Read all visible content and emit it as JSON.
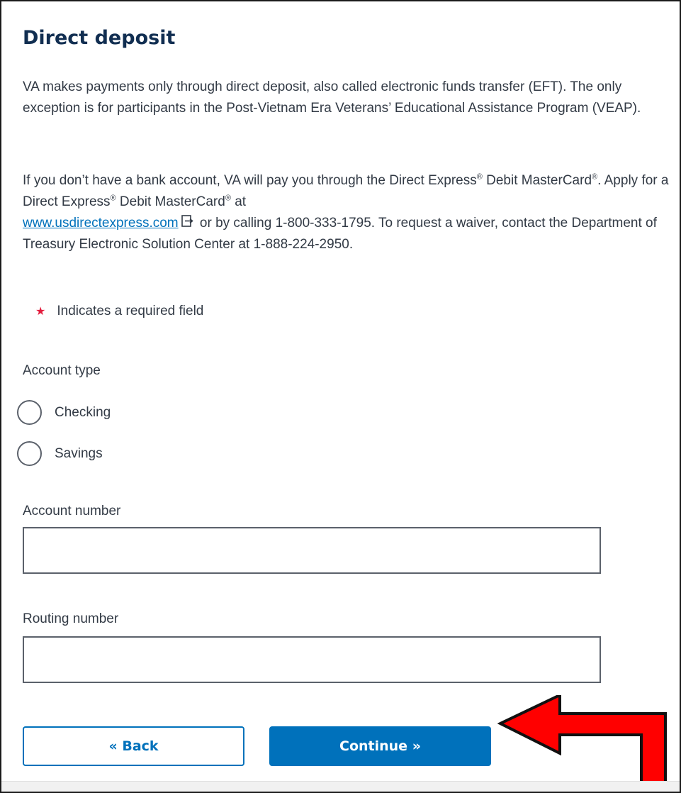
{
  "page": {
    "title": "Direct deposit",
    "intro": {
      "paragraph1": "VA makes payments only through direct deposit, also called electronic funds transfer (EFT). The only exception is for participants in the Post-Vietnam Era Veterans’ Educational Assistance Program (VEAP).",
      "p2_text1": "If you don’t have a bank account, VA will pay you through the Direct Express",
      "reg_mark": "®",
      "p2_text2": " Debit MasterCard",
      "p2_text3": ". Apply for a Direct Express",
      "p2_text4": " Debit MasterCard",
      "p2_text5": " at ",
      "link_text": "www.usdirectexpress.com",
      "p2_text6": " or by calling 1-800-333-1795. To request a waiver, contact the Department of Treasury Electronic Solution Center at 1-888-224-2950."
    },
    "required_note": {
      "star": "★",
      "text": "Indicates a required field"
    }
  },
  "form": {
    "account_type": {
      "label": "Account type",
      "options": [
        "Checking",
        "Savings"
      ],
      "selected": ""
    },
    "account_number": {
      "label": "Account number",
      "value": ""
    },
    "routing_number": {
      "label": "Routing number",
      "value": ""
    }
  },
  "buttons": {
    "back_label": "« Back",
    "continue_label": "Continue »"
  },
  "colors": {
    "heading": "#112e51",
    "primary": "#0071bb",
    "required_star": "#e31c3d",
    "annotation_arrow": "#ff0000"
  },
  "icons": {
    "external_link": "external-link-icon",
    "annotation": "red-arrow-annotation"
  }
}
